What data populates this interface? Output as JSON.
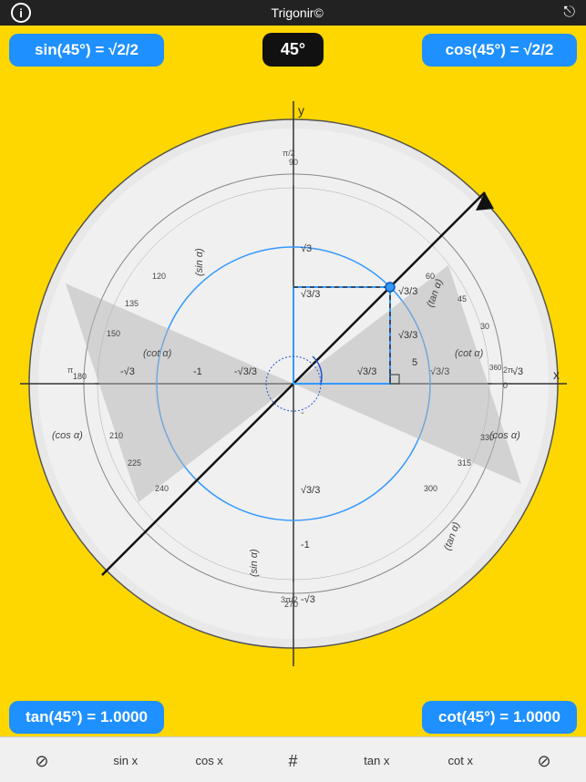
{
  "app": {
    "title": "Trigonir©"
  },
  "header": {
    "sin_label": "sin(45°) = √2/2",
    "angle": "45°",
    "cos_label": "cos(45°) = √2/2"
  },
  "footer": {
    "tan_label": "tan(45°) = 1.0000",
    "cot_label": "cot(45°) = 1.0000"
  },
  "tabs": [
    {
      "label": "",
      "icon": "⊘",
      "name": "clear-tab"
    },
    {
      "label": "sin x",
      "name": "sin-tab"
    },
    {
      "label": "cos x",
      "name": "cos-tab"
    },
    {
      "label": "#",
      "name": "grid-tab"
    },
    {
      "label": "tan x",
      "name": "tan-tab"
    },
    {
      "label": "cot x",
      "name": "cot-tab"
    },
    {
      "label": "⊘",
      "name": "empty-tab"
    }
  ],
  "colors": {
    "yellow": "#FFD700",
    "blue": "#1E90FF",
    "dark": "#111111"
  }
}
